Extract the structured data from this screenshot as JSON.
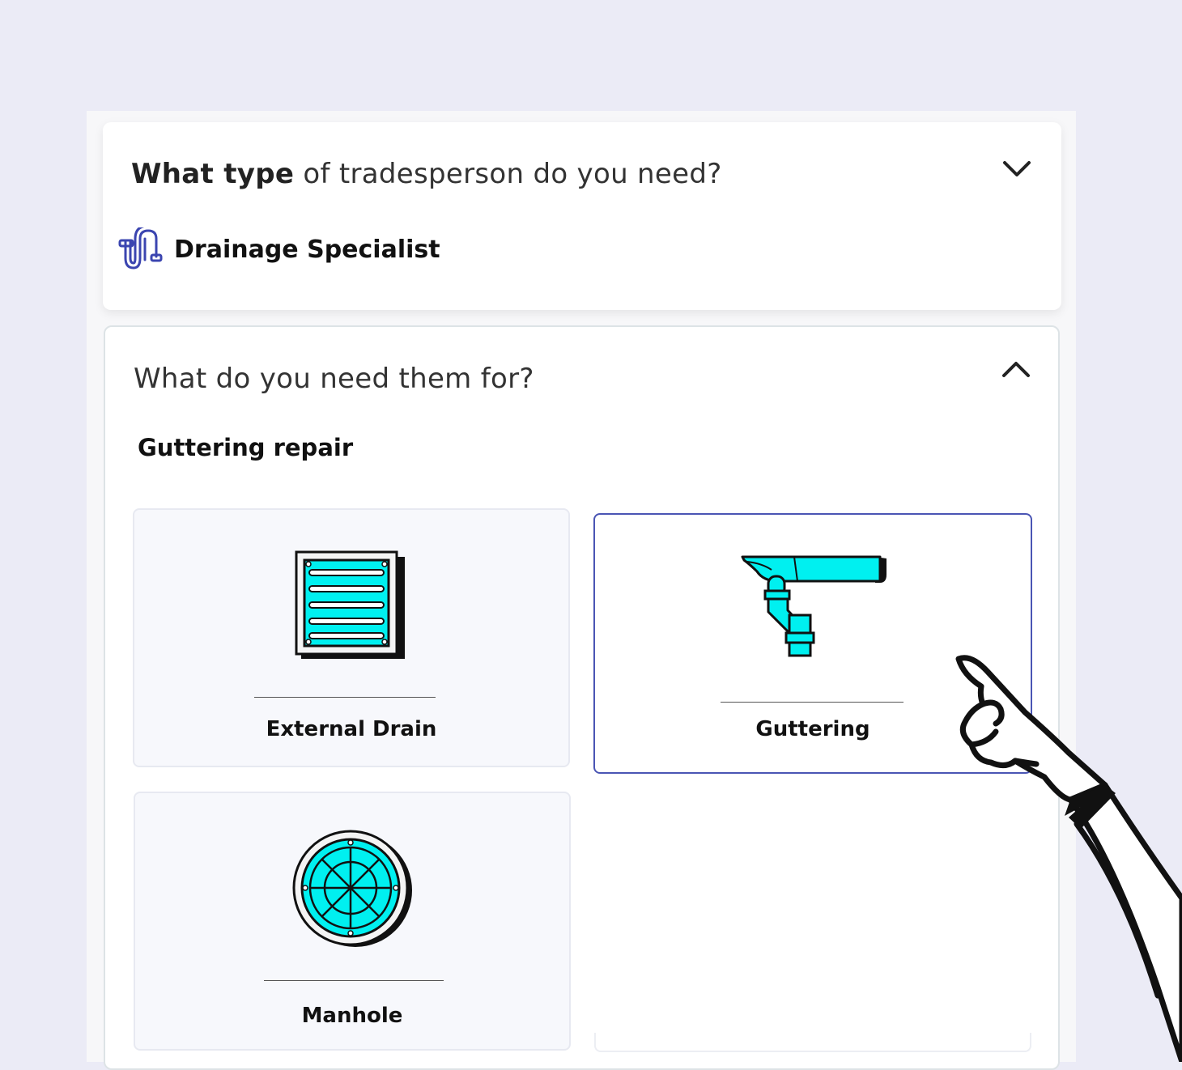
{
  "question1": {
    "title_bold": "What type",
    "title_rest": " of tradesperson do you need?",
    "selected_trade": "Drainage Specialist",
    "selected_trade_icon": "pipe-icon",
    "toggle_icon": "chevron-down-icon"
  },
  "question2": {
    "title": "What do you need them for?",
    "selected_job": "Guttering repair",
    "toggle_icon": "chevron-up-icon",
    "options": [
      {
        "label": "External Drain",
        "icon": "drain-grate-icon",
        "selected": false
      },
      {
        "label": "Guttering",
        "icon": "gutter-pipe-icon",
        "selected": true
      },
      {
        "label": "Manhole",
        "icon": "manhole-cover-icon",
        "selected": false
      }
    ]
  },
  "colors": {
    "accent": "#4a55b4",
    "icon_fill": "#00f0f0",
    "page_bg": "#ebebf6"
  }
}
